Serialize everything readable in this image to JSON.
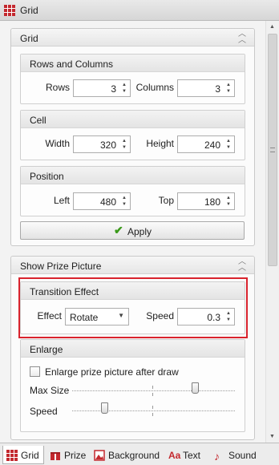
{
  "window": {
    "title": "Grid"
  },
  "grid_panel": {
    "title": "Grid",
    "rows_columns": {
      "title": "Rows and Columns",
      "rows_label": "Rows",
      "rows_value": "3",
      "columns_label": "Columns",
      "columns_value": "3"
    },
    "cell": {
      "title": "Cell",
      "width_label": "Width",
      "width_value": "320",
      "height_label": "Height",
      "height_value": "240"
    },
    "position": {
      "title": "Position",
      "left_label": "Left",
      "left_value": "480",
      "top_label": "Top",
      "top_value": "180"
    },
    "apply_label": "Apply"
  },
  "prize_panel": {
    "title": "Show Prize Picture",
    "transition": {
      "title": "Transition Effect",
      "effect_label": "Effect",
      "effect_value": "Rotate",
      "speed_label": "Speed",
      "speed_value": "0.3"
    },
    "enlarge": {
      "title": "Enlarge",
      "checkbox_label": "Enlarge prize picture after draw",
      "checked": false,
      "max_size_label": "Max Size",
      "max_size_fraction": 0.76,
      "speed_label": "Speed",
      "speed_fraction": 0.2
    }
  },
  "tabs": [
    {
      "label": "Grid",
      "icon": "grid-icon",
      "active": true
    },
    {
      "label": "Prize",
      "icon": "gift-icon",
      "active": false
    },
    {
      "label": "Background",
      "icon": "picture-icon",
      "active": false
    },
    {
      "label": "Text",
      "icon": "text-icon",
      "active": false
    },
    {
      "label": "Sound",
      "icon": "music-note-icon",
      "active": false
    }
  ],
  "colors": {
    "accent_red": "#d9232d",
    "check_green": "#3a9a1a"
  }
}
